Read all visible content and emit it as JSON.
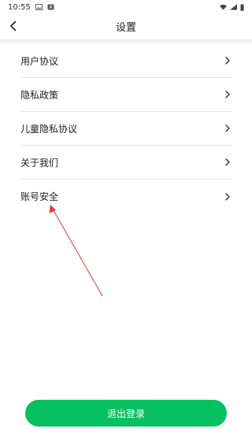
{
  "status_bar": {
    "time": "10:55",
    "left_icons": [
      "image-icon",
      "notification-icon"
    ],
    "right_icons": [
      "wifi-icon",
      "signal-icon",
      "battery-icon"
    ]
  },
  "header": {
    "back_icon": "chevron-left-icon",
    "title": "设置"
  },
  "menu": {
    "items": [
      {
        "label": "用户协议"
      },
      {
        "label": "隐私政策"
      },
      {
        "label": "儿童隐私协议"
      },
      {
        "label": "关于我们"
      },
      {
        "label": "账号安全"
      }
    ]
  },
  "logout": {
    "label": "退出登录",
    "color": "#07c160"
  },
  "annotation": {
    "arrow_color": "#e53935"
  }
}
